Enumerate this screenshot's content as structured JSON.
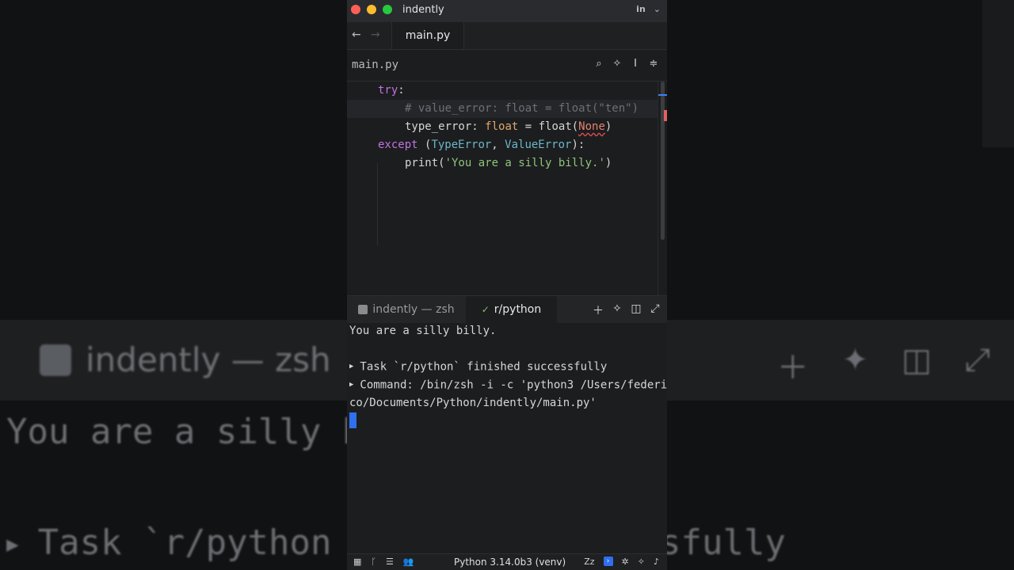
{
  "background": {
    "tab_label": "indently — zsh",
    "line1": "You are a silly b",
    "line2": "Task `r/python",
    "line3": "essfully"
  },
  "window": {
    "title": "indently",
    "title_icons": [
      "in",
      "chevron-down"
    ]
  },
  "tabs": {
    "file_tab": "main.py"
  },
  "editor_toolbar": {
    "filename": "main.py",
    "icons": [
      "search-icon",
      "sparkle-icon",
      "cursor-icon",
      "sliders-icon"
    ]
  },
  "code": {
    "line1_kw": "try",
    "line1_rest": ":",
    "line2_comment": "# value_error: float = float(\"ten\")",
    "line3_a": "type_error: ",
    "line3_type": "float",
    "line3_b": " = float(",
    "line3_none": "None",
    "line3_c": ")",
    "line4_kw": "except",
    "line4_a": " (",
    "line4_cls1": "TypeError",
    "line4_b": ", ",
    "line4_cls2": "ValueError",
    "line4_c": "):",
    "line5_a": "print(",
    "line5_str": "'You are a silly billy.'",
    "line5_b": ")"
  },
  "terminal_tabs": {
    "tab1": "indently — zsh",
    "tab2": "r/python"
  },
  "terminal": {
    "output": "You are a silly billy.",
    "task_line": "Task `r/python` finished successfully",
    "command_line1": "Command: /bin/zsh -i -c 'python3 /Users/federi",
    "command_line2": "co/Documents/Python/indently/main.py'"
  },
  "statusbar": {
    "env": "Python 3.14.0b3 (venv)"
  },
  "colors": {
    "keyword": "#c172e0",
    "comment": "#6c6f73",
    "string": "#8fc47a",
    "type": "#e0a86a",
    "class": "#6ab7c9",
    "accent": "#2f6ff0"
  }
}
